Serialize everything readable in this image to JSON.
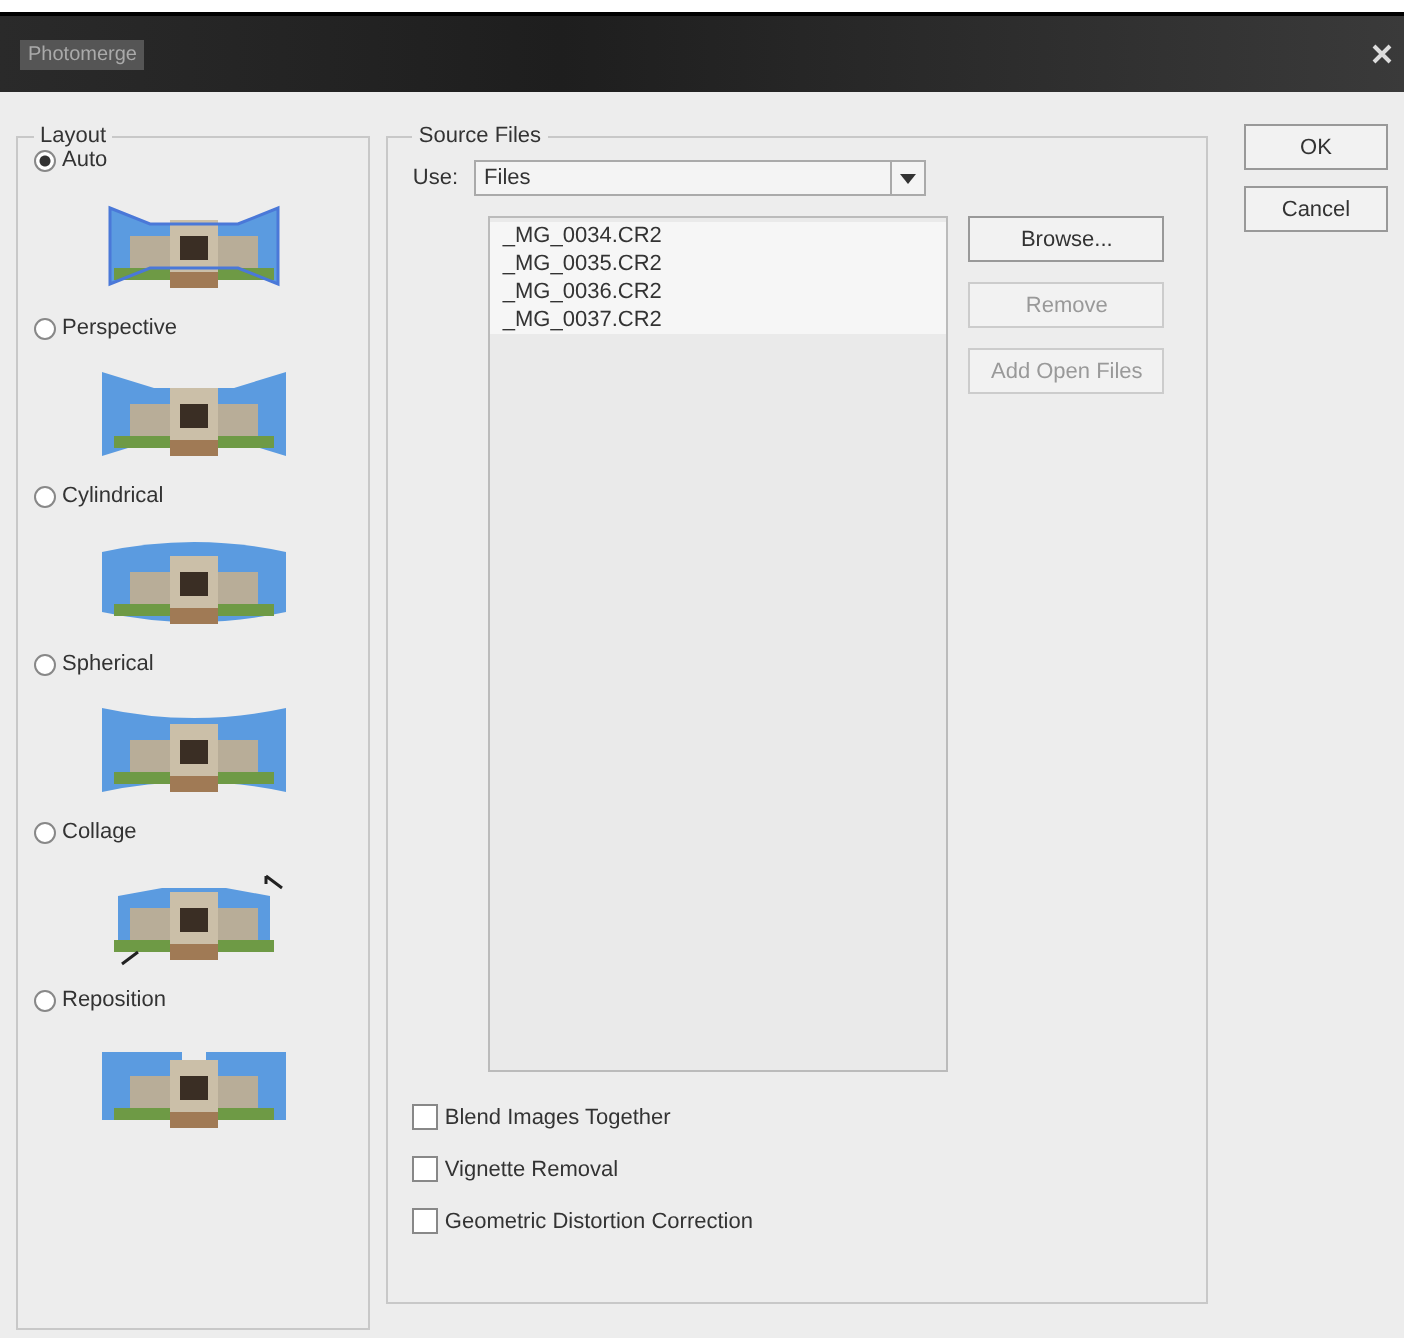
{
  "window": {
    "title": "Photomerge"
  },
  "layout": {
    "legend": "Layout",
    "options": [
      {
        "label": "Auto",
        "kind": "auto",
        "selected": true
      },
      {
        "label": "Perspective",
        "kind": "perspective",
        "selected": false
      },
      {
        "label": "Cylindrical",
        "kind": "cylindrical",
        "selected": false
      },
      {
        "label": "Spherical",
        "kind": "spherical",
        "selected": false
      },
      {
        "label": "Collage",
        "kind": "collage",
        "selected": false
      },
      {
        "label": "Reposition",
        "kind": "reposition",
        "selected": false
      }
    ]
  },
  "source_files": {
    "legend": "Source Files",
    "use_label": "Use:",
    "use_value": "Files",
    "files": [
      "_MG_0034.CR2",
      "_MG_0035.CR2",
      "_MG_0036.CR2",
      "_MG_0037.CR2"
    ],
    "buttons": [
      {
        "label": "Browse...",
        "disabled": false
      },
      {
        "label": "Remove",
        "disabled": true
      },
      {
        "label": "Add Open Files",
        "disabled": true
      }
    ],
    "options": [
      {
        "label": "Blend Images Together",
        "checked": false
      },
      {
        "label": "Vignette Removal",
        "checked": false
      },
      {
        "label": "Geometric Distortion Correction",
        "checked": false
      }
    ]
  },
  "buttons": [
    "OK",
    "Cancel"
  ]
}
